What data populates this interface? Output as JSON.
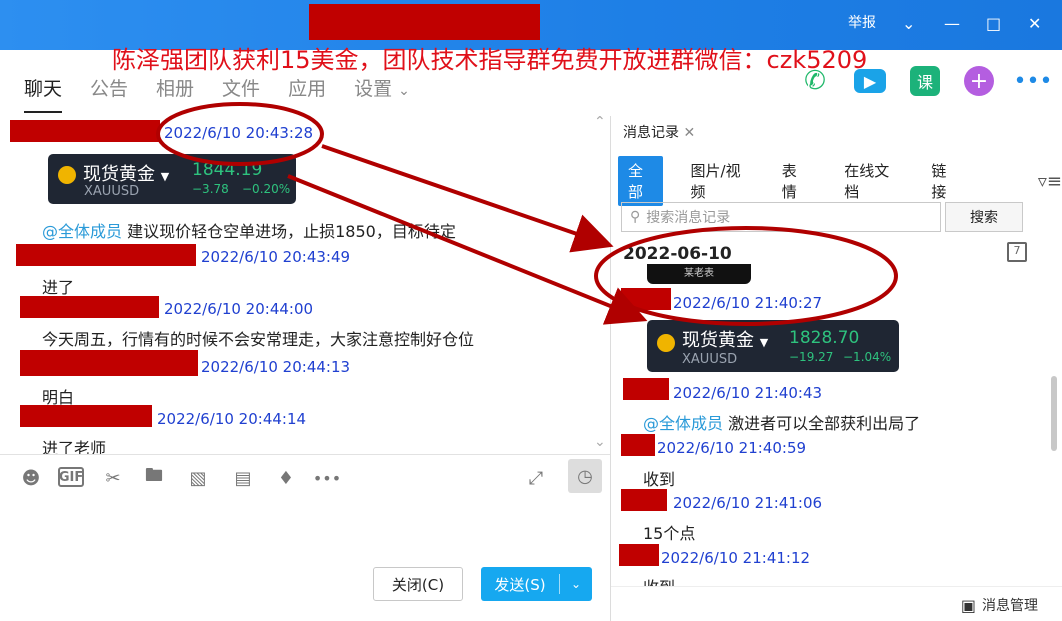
{
  "window": {
    "report_label": "举报"
  },
  "banner": {
    "text": "陈泽强团队获利15美金，团队技术指导群免费开放进群微信：czk5209"
  },
  "nav": {
    "tabs": [
      "聊天",
      "公告",
      "相册",
      "文件",
      "应用",
      "设置"
    ],
    "active": 0
  },
  "tools": {
    "course_label": "课"
  },
  "chat": {
    "card": {
      "name": "现货黄金",
      "symbol": "XAUUSD",
      "price": "1844.19",
      "change": "−3.78",
      "change_pct": "−0.20%"
    },
    "messages": [
      {
        "time": "2022/6/10 20:43:28"
      },
      {
        "mention": "@全体成员",
        "text": "建议现价轻仓空单进场，止损1850，目标待定"
      },
      {
        "time": "2022/6/10 20:43:49",
        "text": "进了"
      },
      {
        "time": "2022/6/10 20:44:00",
        "text": "今天周五，行情有的时候不会安常理走，大家注意控制好仓位"
      },
      {
        "time": "2022/6/10 20:44:13",
        "text": "明白"
      },
      {
        "time": "2022/6/10 20:44:14",
        "text": "进了老师"
      }
    ]
  },
  "composer": {
    "close_label": "关闭(C)",
    "send_label": "发送(S)"
  },
  "history": {
    "tab_label": "消息记录",
    "filters": [
      "全部",
      "图片/视频",
      "表情",
      "在线文档",
      "链接"
    ],
    "search_placeholder": "搜索消息记录",
    "search_button": "搜索",
    "date": "2022-06-10",
    "partial_name": "某老表",
    "card": {
      "name": "现货黄金",
      "symbol": "XAUUSD",
      "price": "1828.70",
      "change": "−19.27",
      "change_pct": "−1.04%"
    },
    "messages": [
      {
        "time": "2022/6/10 21:40:27"
      },
      {
        "time": "2022/6/10 21:40:43",
        "mention": "@全体成员",
        "text": "激进者可以全部获利出局了"
      },
      {
        "time": "2022/6/10 21:40:59",
        "text": "收到"
      },
      {
        "time": "2022/6/10 21:41:06",
        "text": "15个点"
      },
      {
        "time": "2022/6/10 21:41:12",
        "text": "收到"
      }
    ],
    "manage_label": "消息管理"
  }
}
